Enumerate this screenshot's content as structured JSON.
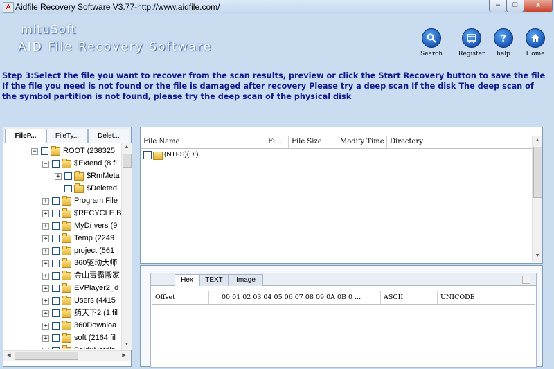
{
  "window": {
    "title": "Aidfile Recovery Software V3.77-http://www.aidfile.com/",
    "minimize_label": "–",
    "maximize_label": "□",
    "close_label": "x"
  },
  "logo": {
    "brand": "mituSoft",
    "product": "AID File Recovery Software"
  },
  "toolbar": {
    "search_label": "Search",
    "register_label": "Register",
    "help_label": "help",
    "home_label": "Home"
  },
  "step_text": "Step 3:Select the file you want to recover from the scan results, preview or click the Start Recovery button to save the file If the file you need is not found or the file is damaged after recovery Please try a deep scan If the disk The deep scan of the symbol partition is not found, please try the deep scan of the physical disk",
  "left_tabs": [
    "FileP...",
    "FileTy...",
    "Delet..."
  ],
  "tree": [
    {
      "label": "ROOT (238325",
      "level": 0,
      "expander": "−"
    },
    {
      "label": "$Extend (8 fi",
      "level": 1,
      "expander": "−"
    },
    {
      "label": "$RmMeta",
      "level": 2,
      "expander": "+"
    },
    {
      "label": "$Deleted",
      "level": 2,
      "expander": ""
    },
    {
      "label": "Program File",
      "level": 1,
      "expander": "+"
    },
    {
      "label": "$RECYCLE.BI",
      "level": 1,
      "expander": "+"
    },
    {
      "label": "MyDrivers (9",
      "level": 1,
      "expander": "+"
    },
    {
      "label": "Temp (2249",
      "level": 1,
      "expander": "+"
    },
    {
      "label": "project (561",
      "level": 1,
      "expander": "+"
    },
    {
      "label": "360驱动大师",
      "level": 1,
      "expander": "+"
    },
    {
      "label": "金山毒霸搬家",
      "level": 1,
      "expander": "+"
    },
    {
      "label": "EVPlayer2_d",
      "level": 1,
      "expander": "+"
    },
    {
      "label": "Users (4415",
      "level": 1,
      "expander": "+"
    },
    {
      "label": "药天下2 (1 fil",
      "level": 1,
      "expander": "+"
    },
    {
      "label": "360Downloa",
      "level": 1,
      "expander": "+"
    },
    {
      "label": "soft (2164 fil",
      "level": 1,
      "expander": "+"
    },
    {
      "label": "BaiduNetdis",
      "level": 1,
      "expander": "+"
    }
  ],
  "file_list": {
    "columns": [
      "File Name",
      "Fi...",
      "File Size",
      "Modify Time",
      "Directory"
    ],
    "rows": [
      {
        "name": "(NTFS)(D:)"
      }
    ]
  },
  "hex_view": {
    "tabs": [
      "Hex",
      "TEXT",
      "Image"
    ],
    "columns": [
      "Offset",
      "00 01 02 03 04 05 06 07   08 09 0A 0B 0 ...",
      "ASCII",
      "UNICODE"
    ]
  }
}
